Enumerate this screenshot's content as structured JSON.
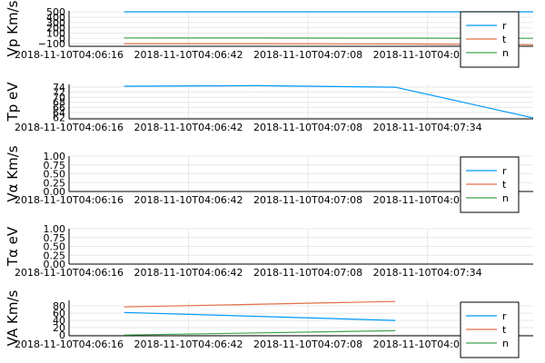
{
  "chart_data": [
    {
      "type": "line",
      "ylabel": "Vp Km/s",
      "ylim": [
        -150,
        520
      ],
      "yticks": [
        -100,
        0,
        100,
        200,
        300,
        400,
        500
      ],
      "ytick_labels": [
        "−100",
        "0",
        "100",
        "200",
        "300",
        "400",
        "500"
      ],
      "xlim": [
        "2018-11-10T04:06:16",
        "2018-11-10T04:07:57"
      ],
      "xticks": [
        "2018-11-10T04:06:16",
        "2018-11-10T04:06:42",
        "2018-11-10T04:07:08",
        "2018-11-10T04:07:34"
      ],
      "xtick_labels": [
        "2018-11-10T04:06:16",
        "2018-11-10T04:06:42",
        "2018-11-10T04:07:08",
        "2018-11-10T04:07:34"
      ],
      "legend": true,
      "series": [
        {
          "name": "r",
          "color": "#009af9",
          "x": [
            "2018-11-10T04:06:28",
            "2018-11-10T04:06:57",
            "2018-11-10T04:07:27",
            "2018-11-10T04:07:57"
          ],
          "y": [
            503,
            503,
            503,
            503
          ]
        },
        {
          "name": "t",
          "color": "#e26f46",
          "x": [
            "2018-11-10T04:06:28",
            "2018-11-10T04:06:57",
            "2018-11-10T04:07:27",
            "2018-11-10T04:07:57"
          ],
          "y": [
            -100,
            -100,
            -105,
            -120
          ]
        },
        {
          "name": "n",
          "color": "#3da44d",
          "x": [
            "2018-11-10T04:06:28",
            "2018-11-10T04:06:57",
            "2018-11-10T04:07:27",
            "2018-11-10T04:07:57"
          ],
          "y": [
            8,
            6,
            5,
            2
          ]
        }
      ]
    },
    {
      "type": "line",
      "ylabel": "Tp eV",
      "ylim": [
        61.5,
        75
      ],
      "yticks": [
        62,
        64,
        66,
        68,
        70,
        72,
        74
      ],
      "ytick_labels": [
        "62",
        "64",
        "66",
        "68",
        "70",
        "72",
        "74"
      ],
      "xlim": [
        "2018-11-10T04:06:16",
        "2018-11-10T04:07:57"
      ],
      "xticks": [
        "2018-11-10T04:06:16",
        "2018-11-10T04:06:42",
        "2018-11-10T04:07:08",
        "2018-11-10T04:07:34"
      ],
      "xtick_labels": [
        "2018-11-10T04:06:16",
        "2018-11-10T04:06:42",
        "2018-11-10T04:07:08",
        "2018-11-10T04:07:34"
      ],
      "legend": false,
      "series": [
        {
          "color": "#009af9",
          "x": [
            "2018-11-10T04:06:28",
            "2018-11-10T04:06:57",
            "2018-11-10T04:07:27",
            "2018-11-10T04:07:57"
          ],
          "y": [
            74.3,
            74.5,
            73.9,
            61.9
          ]
        }
      ]
    },
    {
      "type": "line",
      "ylabel": "Vα Km/s",
      "ylim": [
        0,
        1
      ],
      "yticks": [
        0,
        0.25,
        0.5,
        0.75,
        1.0
      ],
      "ytick_labels": [
        "0.00",
        "0.25",
        "0.50",
        "0.75",
        "1.00"
      ],
      "xlim": [
        "2018-11-10T04:06:16",
        "2018-11-10T04:07:57"
      ],
      "xticks": [
        "2018-11-10T04:06:16",
        "2018-11-10T04:06:42",
        "2018-11-10T04:07:08",
        "2018-11-10T04:07:34"
      ],
      "xtick_labels": [
        "2018-11-10T04:06:16",
        "2018-11-10T04:06:42",
        "2018-11-10T04:07:08",
        "2018-11-10T04:07:34"
      ],
      "legend": true,
      "series": [
        {
          "name": "r",
          "color": "#009af9",
          "x": [],
          "y": []
        },
        {
          "name": "t",
          "color": "#e26f46",
          "x": [],
          "y": []
        },
        {
          "name": "n",
          "color": "#3da44d",
          "x": [],
          "y": []
        }
      ]
    },
    {
      "type": "line",
      "ylabel": "Tα eV",
      "ylim": [
        0,
        1
      ],
      "yticks": [
        0,
        0.25,
        0.5,
        0.75,
        1.0
      ],
      "ytick_labels": [
        "0.00",
        "0.25",
        "0.50",
        "0.75",
        "1.00"
      ],
      "xlim": [
        "2018-11-10T04:06:16",
        "2018-11-10T04:07:57"
      ],
      "xticks": [
        "2018-11-10T04:06:16",
        "2018-11-10T04:06:42",
        "2018-11-10T04:07:08",
        "2018-11-10T04:07:34"
      ],
      "xtick_labels": [
        "2018-11-10T04:06:16",
        "2018-11-10T04:06:42",
        "2018-11-10T04:07:08",
        "2018-11-10T04:07:34"
      ],
      "legend": false,
      "series": []
    },
    {
      "type": "line",
      "ylabel": "VA Km/s",
      "ylim": [
        -2,
        95
      ],
      "yticks": [
        0,
        20,
        40,
        60,
        80
      ],
      "ytick_labels": [
        "0",
        "20",
        "40",
        "60",
        "80"
      ],
      "xlim": [
        "2018-11-10T04:06:16",
        "2018-11-10T04:07:57"
      ],
      "xticks": [
        "2018-11-10T04:06:16",
        "2018-11-10T04:06:42",
        "2018-11-10T04:07:08",
        "2018-11-10T04:07:34"
      ],
      "xtick_labels": [
        "2018-11-10T04:06:16",
        "2018-11-10T04:06:42",
        "2018-11-10T04:07:08",
        "2018-11-10T04:07:34"
      ],
      "legend": true,
      "series": [
        {
          "name": "r",
          "color": "#009af9",
          "x": [
            "2018-11-10T04:06:28",
            "2018-11-10T04:07:27"
          ],
          "y": [
            62,
            40
          ]
        },
        {
          "name": "t",
          "color": "#e26f46",
          "x": [
            "2018-11-10T04:06:28",
            "2018-11-10T04:07:27"
          ],
          "y": [
            77,
            92
          ]
        },
        {
          "name": "n",
          "color": "#3da44d",
          "x": [
            "2018-11-10T04:06:28",
            "2018-11-10T04:07:27"
          ],
          "y": [
            0,
            12
          ]
        }
      ]
    }
  ]
}
